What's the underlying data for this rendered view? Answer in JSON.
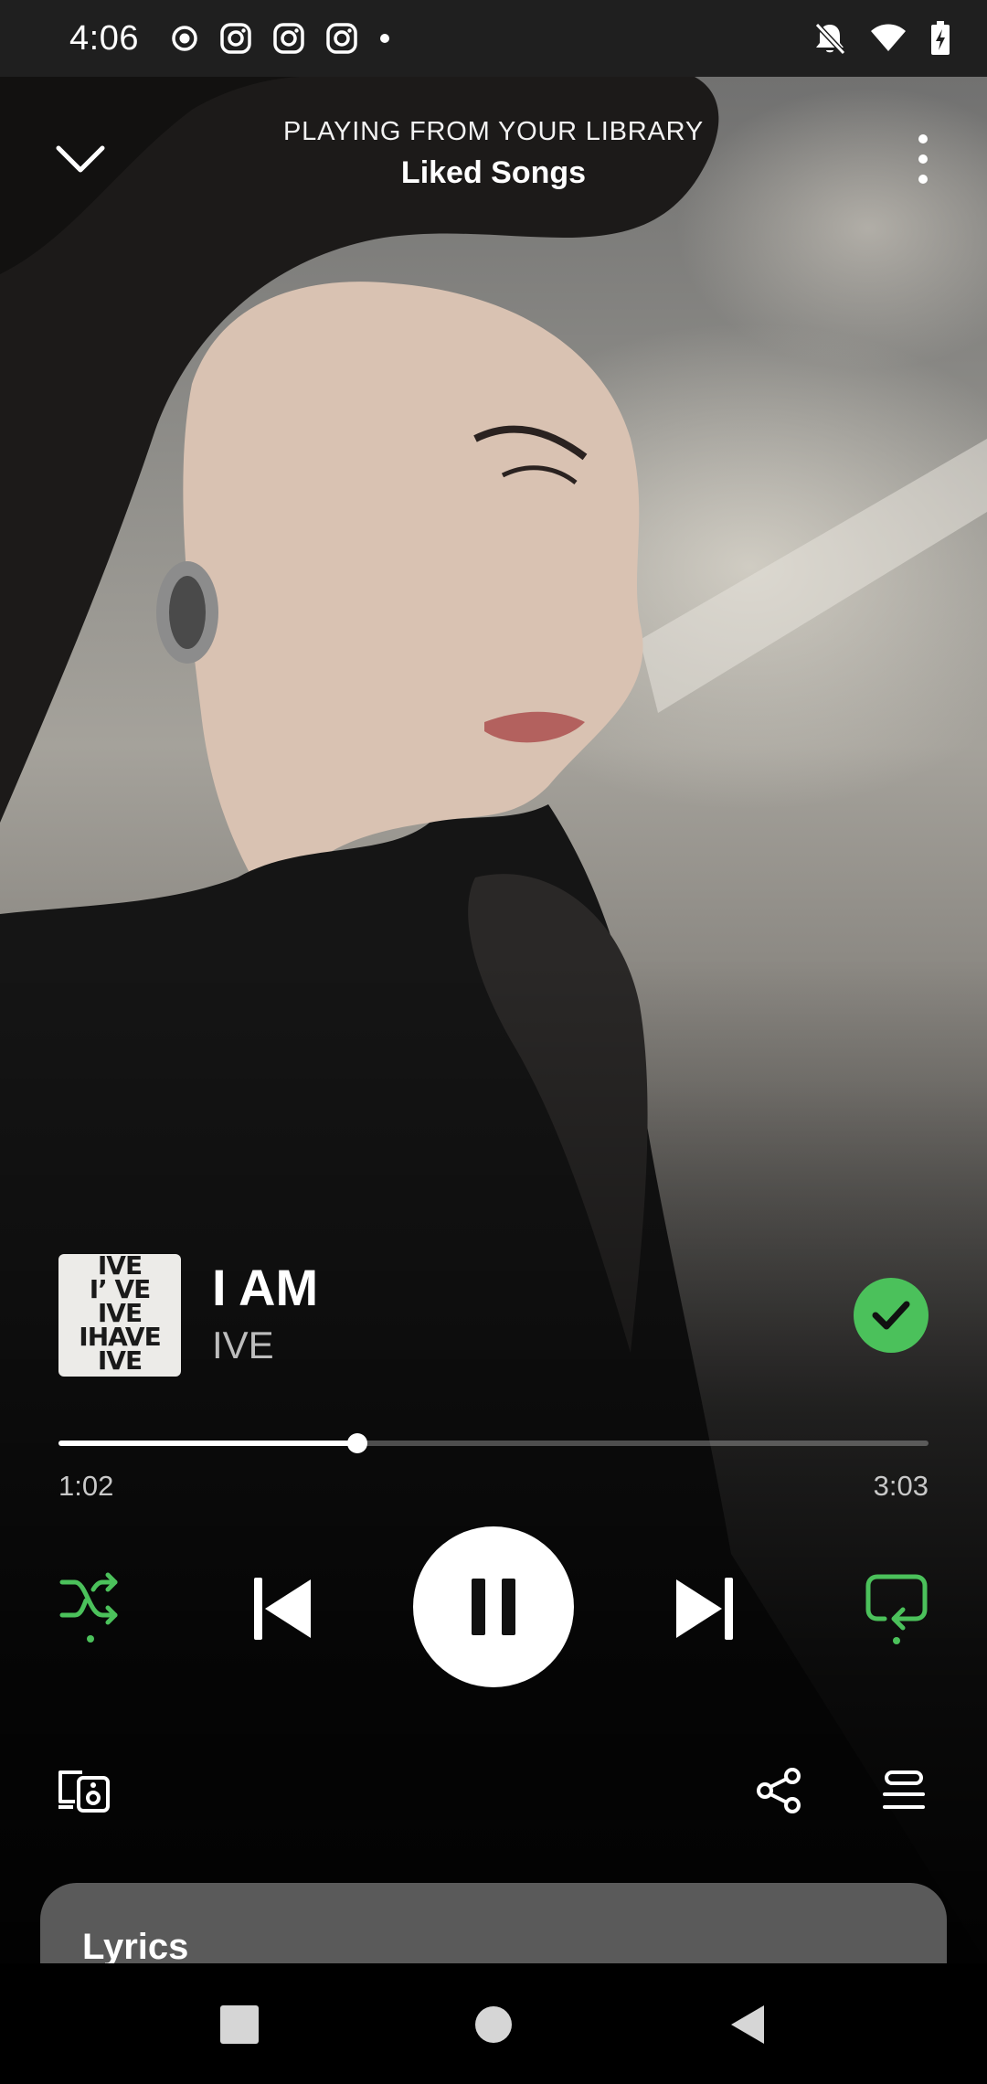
{
  "status_bar": {
    "time": "4:06"
  },
  "header": {
    "context_label": "PLAYING FROM YOUR LIBRARY",
    "context_title": "Liked Songs"
  },
  "track": {
    "title": "I AM",
    "artist": "IVE",
    "album_art_lines": [
      "IVE",
      "I’ VE",
      "IVE",
      "IHAVE",
      "IVE"
    ],
    "liked": true
  },
  "playback": {
    "elapsed": "1:02",
    "duration": "3:03",
    "progress_fraction": 0.343,
    "is_playing": true,
    "shuffle_on": true,
    "repeat_on": true
  },
  "lyrics": {
    "title": "Lyrics"
  },
  "colors": {
    "accent_green": "#4bc15b",
    "status_bar_bg": "#1f1f1f",
    "lyrics_card_bg": "#5a5a5a"
  },
  "icons": {
    "collapse": "chevron-down-icon",
    "more": "more-vertical-icon",
    "liked": "check-circle-icon",
    "shuffle": "shuffle-icon",
    "previous": "skip-previous-icon",
    "pause": "pause-icon",
    "next": "skip-next-icon",
    "repeat": "repeat-icon",
    "devices": "connect-devices-icon",
    "share": "share-icon",
    "queue": "queue-icon"
  }
}
